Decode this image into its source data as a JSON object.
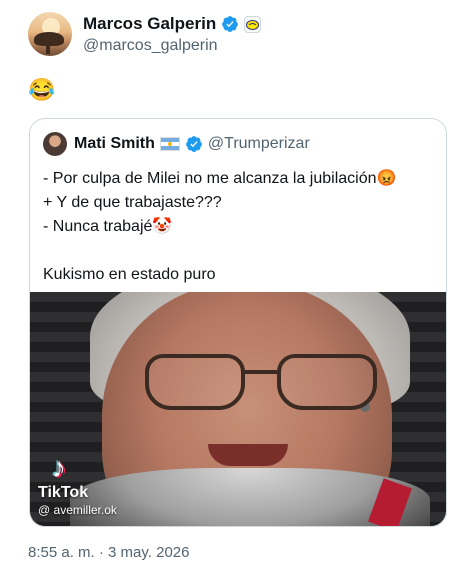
{
  "author": {
    "name": "Marcos Galperin",
    "handle": "@marcos_galperin"
  },
  "post": {
    "emoji": "😂",
    "timestamp": "8:55 a. m. · 3 may. 2026"
  },
  "quoted": {
    "name": "Mati Smith",
    "handle": "@Trumperizar",
    "flag": "argentina-flag",
    "lines": [
      "- Por culpa de Milei no me alcanza la jubilación😡",
      "+ Y de que trabajaste???",
      "- Nunca trabajé🤡",
      "",
      "Kukismo en estado puro"
    ],
    "media": {
      "watermark_brand": "TikTok",
      "watermark_user": "@ avemiller.ok"
    }
  },
  "colors": {
    "verified_blue": "#1d9bf0",
    "text_primary": "#0f1419",
    "text_secondary": "#536471",
    "border": "#cfd9de"
  }
}
